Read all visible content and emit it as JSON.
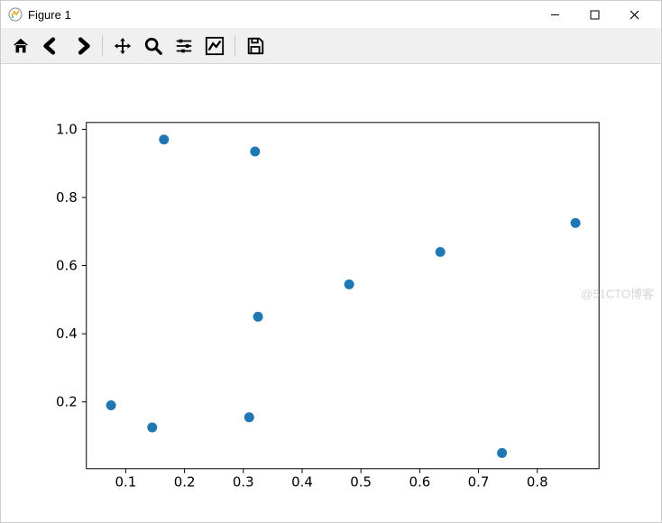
{
  "window": {
    "title": "Figure 1"
  },
  "toolbar_icons": {
    "home": "home-icon",
    "back": "back-icon",
    "forward": "forward-icon",
    "pan": "move-icon",
    "zoom": "zoom-icon",
    "subplots": "sliders-icon",
    "axes": "chart-line-icon",
    "save": "save-icon"
  },
  "watermark": "@51CTO博客",
  "chart_data": {
    "type": "scatter",
    "x": [
      0.075,
      0.145,
      0.165,
      0.31,
      0.32,
      0.325,
      0.48,
      0.635,
      0.74,
      0.865
    ],
    "y": [
      0.19,
      0.125,
      0.97,
      0.155,
      0.935,
      0.45,
      0.545,
      0.64,
      0.05,
      0.725
    ],
    "title": "",
    "xlabel": "",
    "ylabel": "",
    "xlim": [
      0.033,
      0.905
    ],
    "ylim": [
      0.004,
      1.02
    ],
    "xticks": [
      0.1,
      0.2,
      0.3,
      0.4,
      0.5,
      0.6,
      0.7,
      0.8
    ],
    "yticks": [
      0.2,
      0.4,
      0.6,
      0.8,
      1.0
    ],
    "marker_color": "#1f77b4",
    "marker_radius": 5.5
  }
}
